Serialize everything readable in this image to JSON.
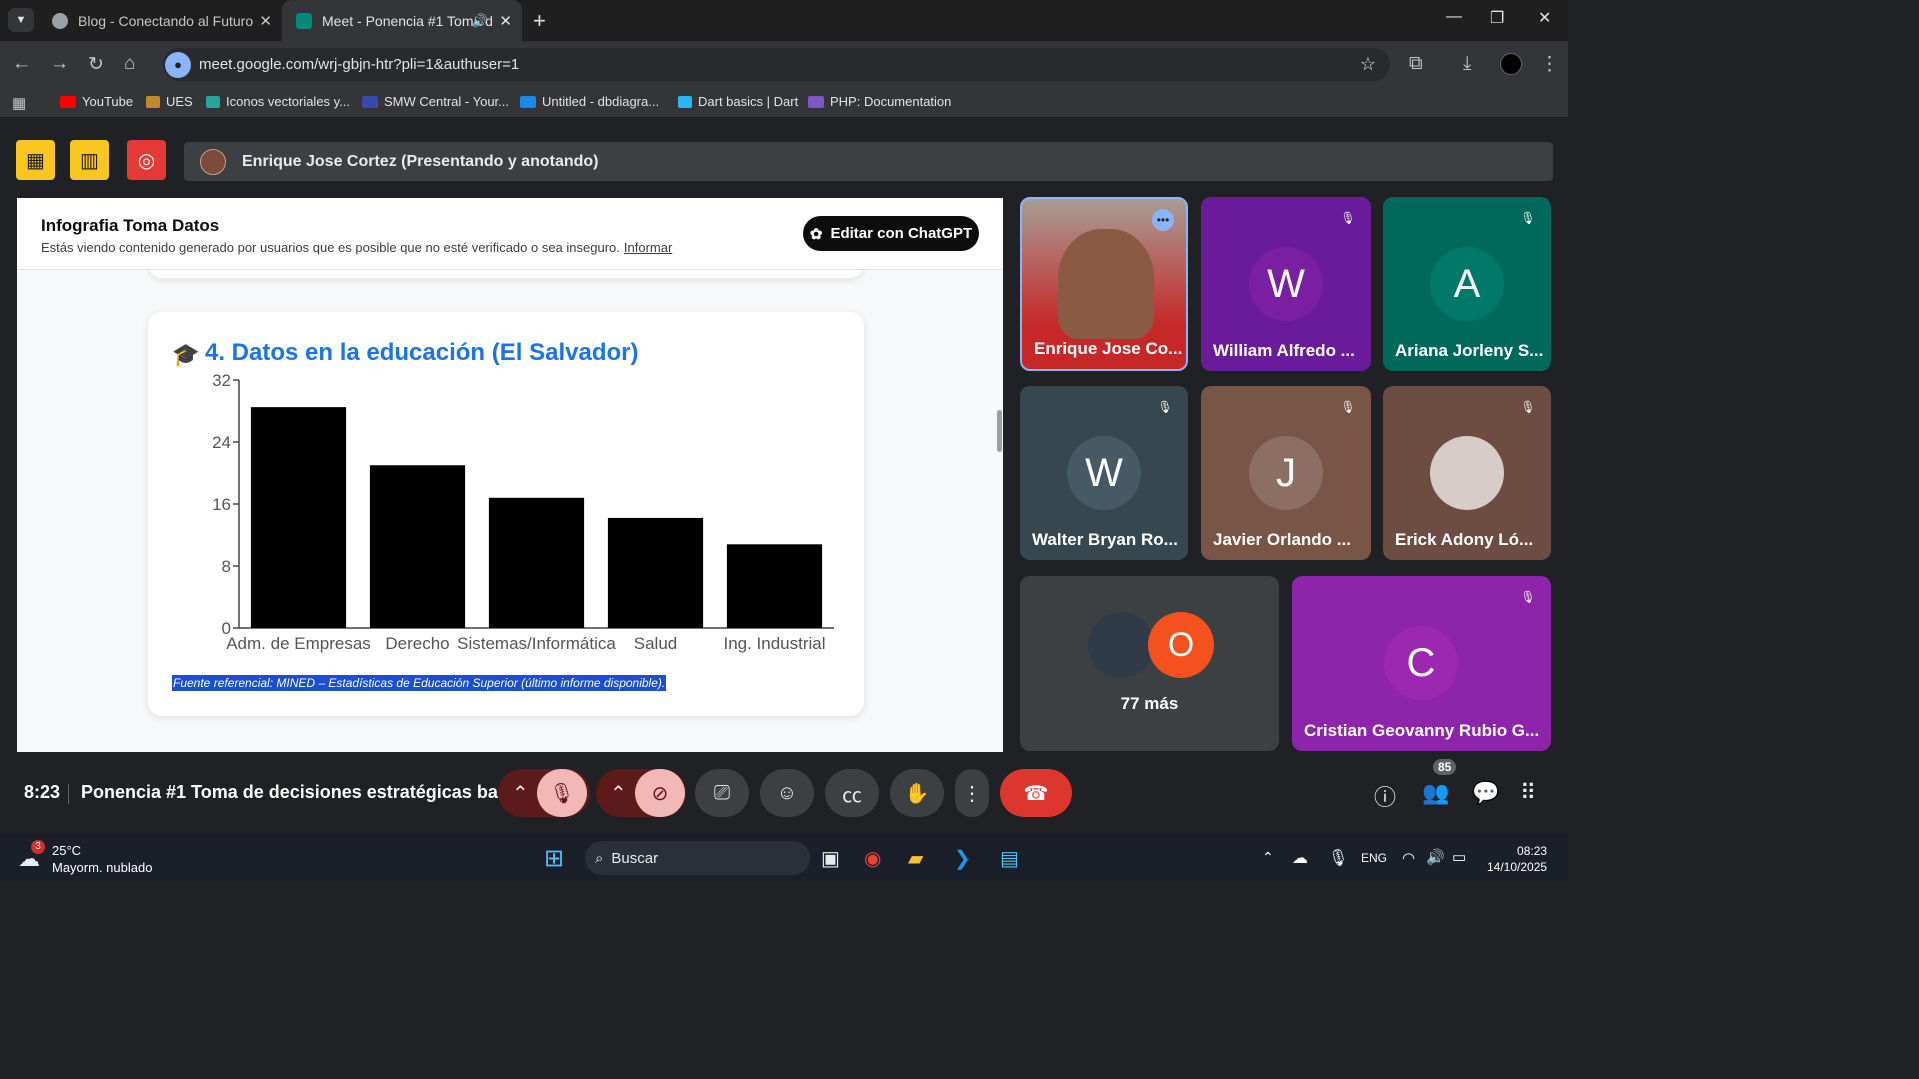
{
  "browser": {
    "tabs": [
      {
        "title": "Blog - Conectando al Futuro"
      },
      {
        "title": "Meet - Ponencia #1 Toma d"
      }
    ],
    "url": "meet.google.com/wrj-gbjn-htr?pli=1&authuser=1",
    "bookmarks": [
      "YouTube",
      "UES",
      "Iconos vectoriales y...",
      "SMW Central - Your...",
      "Untitled - dbdiagra...",
      "Dart basics | Dart",
      "PHP: Documentation"
    ]
  },
  "meet": {
    "presenter_label": "Enrique Jose Cortez (Presentando y anotando)",
    "shared": {
      "banner_title": "Infografia Toma Datos",
      "banner_subtitle": "Estás viendo contenido generado por usuarios que es posible que no esté verificado o sea inseguro.",
      "banner_link": "Informar",
      "edit_button": "Editar con ChatGPT",
      "section_title": "4. Datos en la educación (El Salvador)",
      "source_note": "Fuente referencial: MINED – Estadísticas de Educación Superior (último informe disponible)."
    },
    "participants": [
      {
        "name": "Enrique Jose Co...",
        "initial": "",
        "color": "#c62828"
      },
      {
        "name": "William Alfredo ...",
        "initial": "W",
        "color": "#6a1b9a"
      },
      {
        "name": "Ariana Jorleny S...",
        "initial": "A",
        "color": "#00695c"
      },
      {
        "name": "Walter Bryan Ro...",
        "initial": "W",
        "color": "#37474f"
      },
      {
        "name": "Javier Orlando ...",
        "initial": "J",
        "color": "#795548"
      },
      {
        "name": "Erick Adony Ló...",
        "initial": "",
        "color": "#6d4c41"
      },
      {
        "name": "Cristian Geovanny Rubio G...",
        "initial": "C",
        "color": "#8e24aa"
      }
    ],
    "more": {
      "label": "77 más",
      "initial": "O"
    },
    "bottom": {
      "time": "8:23",
      "title": "Ponencia #1 Toma de decisiones estratégicas bas...",
      "people_count": "85"
    }
  },
  "chart_data": {
    "type": "bar",
    "categories": [
      "Adm. de Empresas",
      "Derecho",
      "Sistemas/Informática",
      "Salud",
      "Ing. Industrial"
    ],
    "values": [
      28.5,
      21,
      16.8,
      14.2,
      10.8
    ],
    "yticks": [
      "0",
      "8",
      "16",
      "24",
      "32"
    ],
    "ylim": [
      0,
      32
    ],
    "bar_color": "#000000"
  },
  "taskbar": {
    "weather_temp": "25°C",
    "weather_desc": "Mayorm. nublado",
    "weather_badge": "3",
    "search": "Buscar",
    "lang": "ENG",
    "time": "08:23",
    "date": "14/10/2025"
  }
}
